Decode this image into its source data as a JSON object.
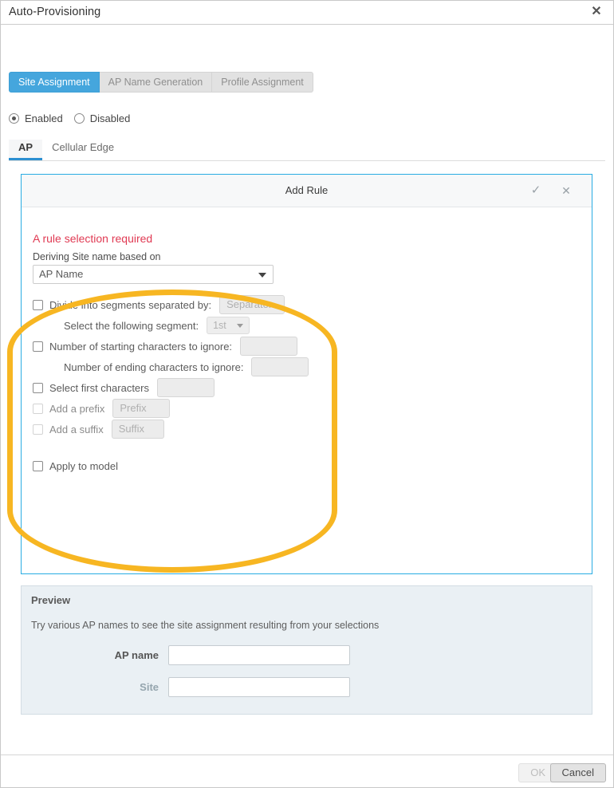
{
  "window": {
    "title": "Auto-Provisioning",
    "close_icon": "close-icon",
    "close_glyph": "✕"
  },
  "pill_tabs": [
    {
      "label": "Site Assignment",
      "active": true
    },
    {
      "label": "AP Name Generation",
      "active": false
    },
    {
      "label": "Profile Assignment",
      "active": false
    }
  ],
  "state_radios": [
    {
      "label": "Enabled",
      "checked": true
    },
    {
      "label": "Disabled",
      "checked": false
    }
  ],
  "line_tabs": [
    {
      "label": "AP",
      "active": true
    },
    {
      "label": "Cellular Edge",
      "active": false
    }
  ],
  "rule_panel": {
    "title": "Add Rule",
    "accept_icon": "check-icon",
    "accept_glyph": "✓",
    "dismiss_icon": "close-icon",
    "dismiss_glyph": "✕",
    "error": "A rule selection required",
    "deriving_label": "Deriving Site name based on",
    "deriving_value": "AP Name",
    "rows": [
      {
        "name": "divide-into-segments",
        "checkbox": true,
        "checkbox_dim": false,
        "label": "Divide into segments separated by:",
        "label_dim": false,
        "control": "input",
        "control_width": 82,
        "control_text": "Separator"
      },
      {
        "name": "select-following-segment",
        "checkbox": false,
        "checkbox_dim": false,
        "label": "Select the following segment:",
        "label_dim": false,
        "control": "select",
        "control_text": "1st",
        "indent": 18
      },
      {
        "name": "starting-characters-to-ignore",
        "checkbox": true,
        "checkbox_dim": false,
        "label": "Number of starting characters to ignore:",
        "label_dim": false,
        "control": "input",
        "control_width": 72,
        "control_text": ""
      },
      {
        "name": "ending-characters-to-ignore",
        "checkbox": false,
        "checkbox_dim": false,
        "label": "Number of ending characters to ignore:",
        "label_dim": false,
        "control": "input",
        "control_width": 72,
        "control_text": "",
        "indent": 18
      },
      {
        "name": "select-first-characters",
        "checkbox": true,
        "checkbox_dim": false,
        "label": "Select first characters",
        "label_dim": false,
        "control": "input",
        "control_width": 72,
        "control_text": ""
      },
      {
        "name": "add-a-prefix",
        "checkbox": true,
        "checkbox_dim": true,
        "label": "Add a prefix",
        "label_dim": true,
        "control": "input",
        "control_width": 72,
        "control_text": "Prefix"
      },
      {
        "name": "add-a-suffix",
        "checkbox": true,
        "checkbox_dim": true,
        "label": "Add a suffix",
        "label_dim": true,
        "control": "input",
        "control_width": 66,
        "control_text": "Suffix"
      },
      {
        "name": "apply-to-model",
        "checkbox": true,
        "checkbox_dim": false,
        "label": "Apply to model",
        "label_dim": false,
        "control": "none",
        "gap_before": 20
      }
    ]
  },
  "highlight": {
    "name": "highlight-ellipse",
    "color": "#f7b622"
  },
  "preview": {
    "title": "Preview",
    "subtitle": "Try various AP names to see the site assignment resulting from your selections",
    "fields": [
      {
        "label": "AP name",
        "value": "",
        "muted": false
      },
      {
        "label": "Site",
        "value": "",
        "muted": true
      }
    ]
  },
  "footer": {
    "ok_label": "OK",
    "cancel_label": "Cancel"
  },
  "colors": {
    "accent_blue": "#45a6dd",
    "panel_border": "#29ace3",
    "error_red": "#e03a53",
    "highlight_yellow": "#f7b622",
    "preview_bg": "#eaf0f4"
  }
}
